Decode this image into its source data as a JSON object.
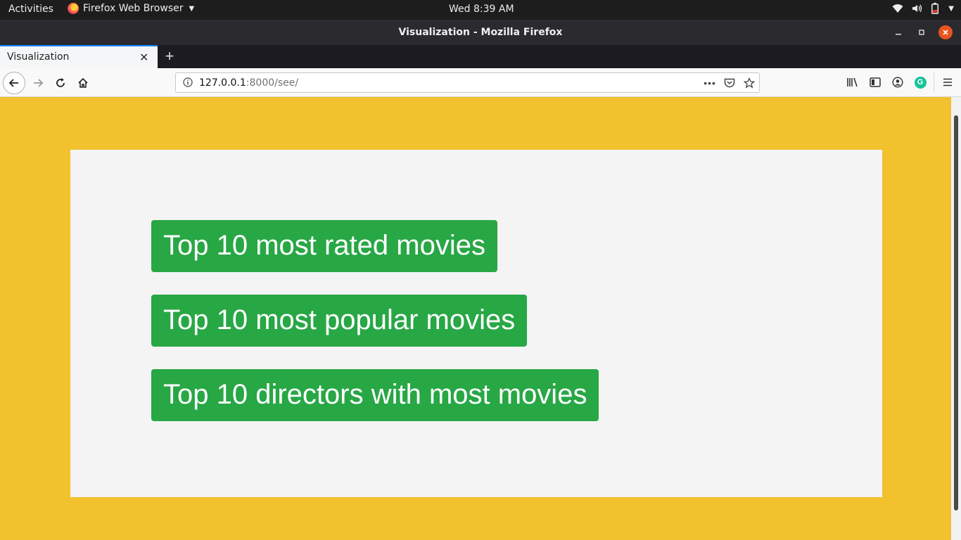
{
  "system_bar": {
    "activities": "Activities",
    "app_name": "Firefox Web Browser",
    "clock": "Wed  8:39 AM"
  },
  "window": {
    "title": "Visualization - Mozilla Firefox"
  },
  "tabs": [
    {
      "label": "Visualization",
      "active": true
    }
  ],
  "address_bar": {
    "host": "127.0.0.1",
    "path": ":8000/see/"
  },
  "page": {
    "buttons": [
      {
        "label": "Top 10 most rated movies"
      },
      {
        "label": "Top 10 most popular movies"
      },
      {
        "label": "Top 10 directors with most movies"
      }
    ]
  },
  "colors": {
    "page_background": "#f2c12e",
    "panel_background": "#f4f4f4",
    "button_green": "#28a745",
    "tab_accent": "#0a84ff",
    "close_button": "#e95420"
  }
}
